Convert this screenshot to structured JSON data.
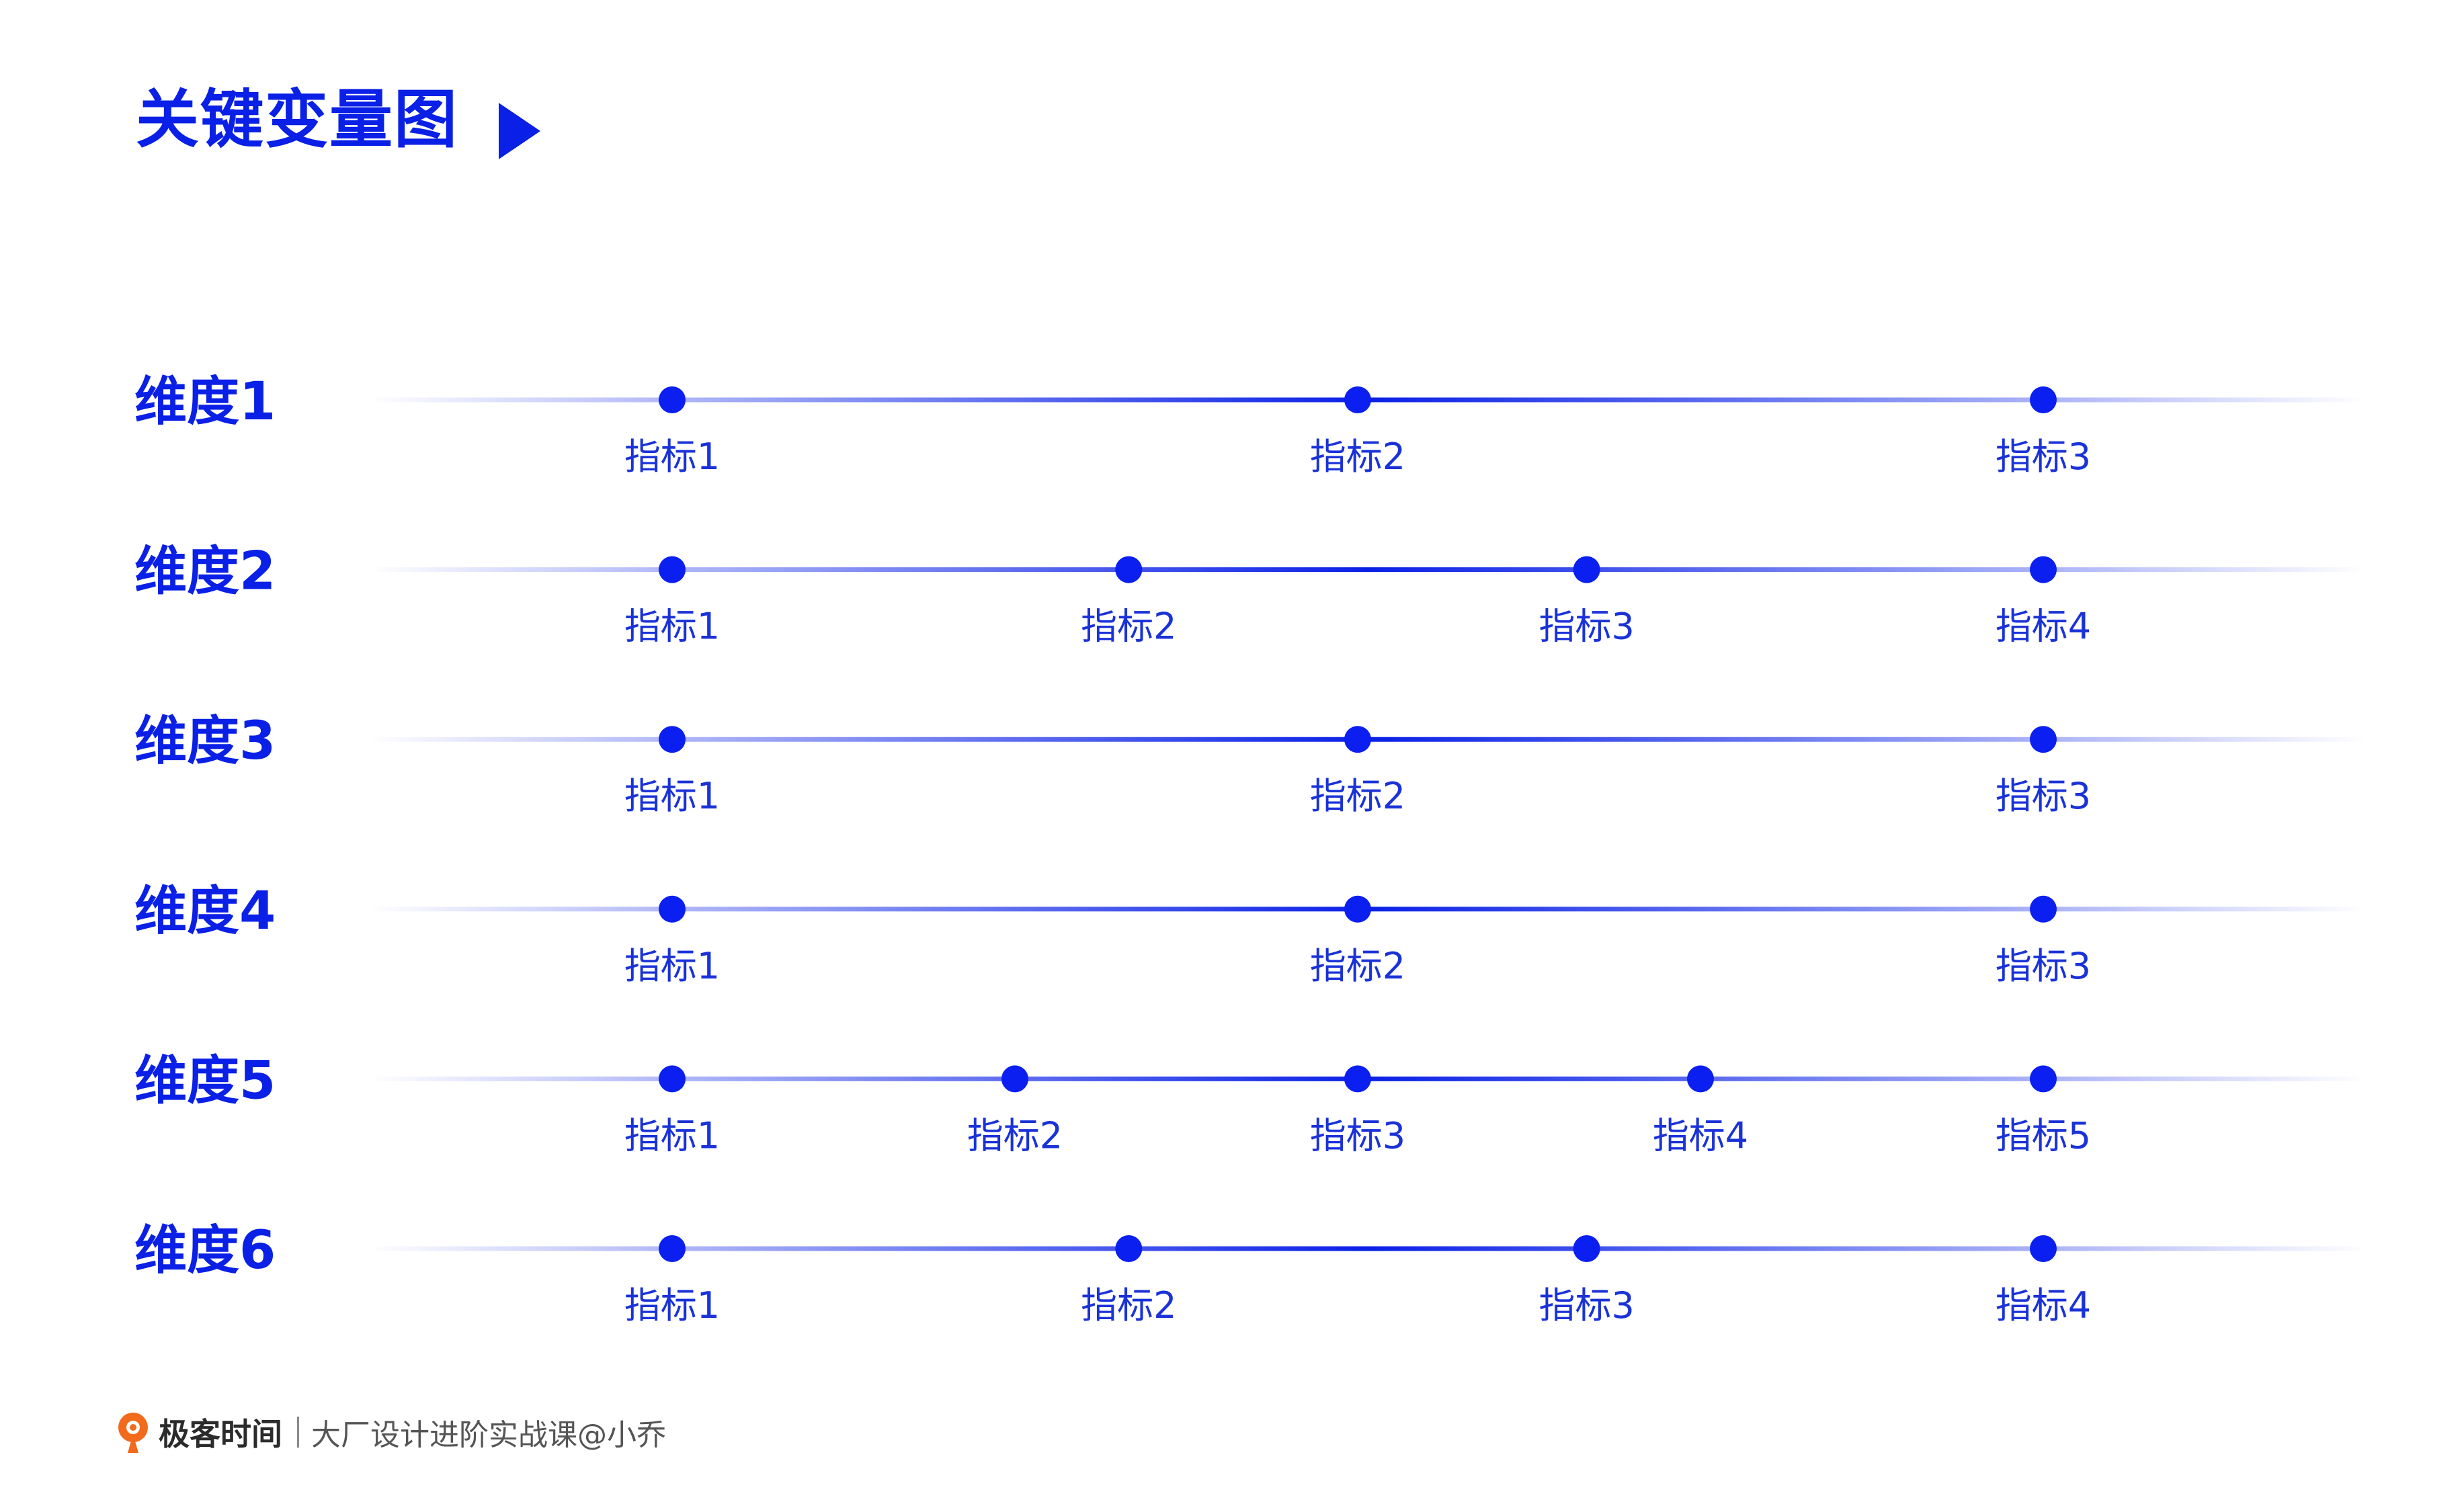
{
  "title": "关键变量图",
  "colors": {
    "accent": "#0a20e6",
    "dot": "#0a1ff0",
    "label": "#1a32d8"
  },
  "chart_data": {
    "type": "dot_line",
    "rows": [
      {
        "label": "维度1",
        "points": [
          {
            "label": "指标1",
            "pos": 0.0
          },
          {
            "label": "指标2",
            "pos": 0.5
          },
          {
            "label": "指标3",
            "pos": 1.0
          }
        ]
      },
      {
        "label": "维度2",
        "points": [
          {
            "label": "指标1",
            "pos": 0.0
          },
          {
            "label": "指标2",
            "pos": 0.333
          },
          {
            "label": "指标3",
            "pos": 0.667
          },
          {
            "label": "指标4",
            "pos": 1.0
          }
        ]
      },
      {
        "label": "维度3",
        "points": [
          {
            "label": "指标1",
            "pos": 0.0
          },
          {
            "label": "指标2",
            "pos": 0.5
          },
          {
            "label": "指标3",
            "pos": 1.0
          }
        ]
      },
      {
        "label": "维度4",
        "points": [
          {
            "label": "指标1",
            "pos": 0.0
          },
          {
            "label": "指标2",
            "pos": 0.5
          },
          {
            "label": "指标3",
            "pos": 1.0
          }
        ]
      },
      {
        "label": "维度5",
        "points": [
          {
            "label": "指标1",
            "pos": 0.0
          },
          {
            "label": "指标2",
            "pos": 0.25
          },
          {
            "label": "指标3",
            "pos": 0.5
          },
          {
            "label": "指标4",
            "pos": 0.75
          },
          {
            "label": "指标5",
            "pos": 1.0
          }
        ]
      },
      {
        "label": "维度6",
        "points": [
          {
            "label": "指标1",
            "pos": 0.0
          },
          {
            "label": "指标2",
            "pos": 0.333
          },
          {
            "label": "指标3",
            "pos": 0.667
          },
          {
            "label": "指标4",
            "pos": 1.0
          }
        ]
      }
    ]
  },
  "footer": {
    "brand": "极客时间",
    "course": "大厂设计进阶实战课@小乔",
    "logo_icon": "geektime-logo-icon"
  }
}
